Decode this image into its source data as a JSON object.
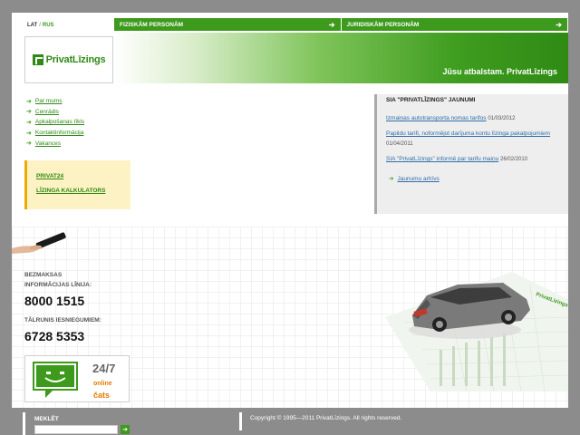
{
  "lang": {
    "lat": "LAT",
    "rus": "RUS"
  },
  "topnav": {
    "tabs": [
      {
        "label": "FIZISKĀM PERSONĀM"
      },
      {
        "label": "JURIDISKĀM PERSONĀM"
      }
    ]
  },
  "logo": {
    "text": "PrivatLīzings"
  },
  "banner": {
    "slogan": "Jūsu atbalstam. PrivatLīzings"
  },
  "leftmenu": {
    "items": [
      {
        "label": "Par mums"
      },
      {
        "label": "Cenrādis"
      },
      {
        "label": "Apkalpošanas tīkls"
      },
      {
        "label": "Kontaktinformācija"
      },
      {
        "label": "Vakances"
      }
    ]
  },
  "promo": {
    "links": [
      {
        "label": "PRIVAT24"
      },
      {
        "label": "LĪZINGA KALKULATORS"
      }
    ]
  },
  "hotline": {
    "free_label_1": "BEZMAKSAS",
    "free_label_2": "INFORMĀCIJAS LĪNIJA:",
    "free_number": "8000 1515",
    "sub_label": "TĀLRUNIS IESNIEGUMIEM:",
    "sub_number": "6728 5353"
  },
  "chat": {
    "hours": "24/7",
    "online": "online",
    "label": "čats"
  },
  "news": {
    "title": "SIA \"PRIVATLĪZINGS\" JAUNUMI",
    "items": [
      {
        "text": "Izmaiņas autotransporta nomas tarifos",
        "date": "01/03/2012"
      },
      {
        "text": "Papildu tarifi, noformējot darījuma kontu līzinga pakalpojumiem",
        "date": "01/04/2011"
      },
      {
        "text": "SIA \"PrivatLīzings\" informē par tarifu maiņu",
        "date": "26/02/2010"
      }
    ],
    "archive": "Jaunumu arhīvs"
  },
  "footer": {
    "search_label": "MEKLĒT",
    "search_value": "",
    "copyright": "Copyright © 1995—2011 PrivatLīzings. All rights reserved."
  },
  "colors": {
    "brand_green": "#3d9a1c",
    "link_blue": "#2f6fa8",
    "accent_orange": "#e07b00"
  }
}
